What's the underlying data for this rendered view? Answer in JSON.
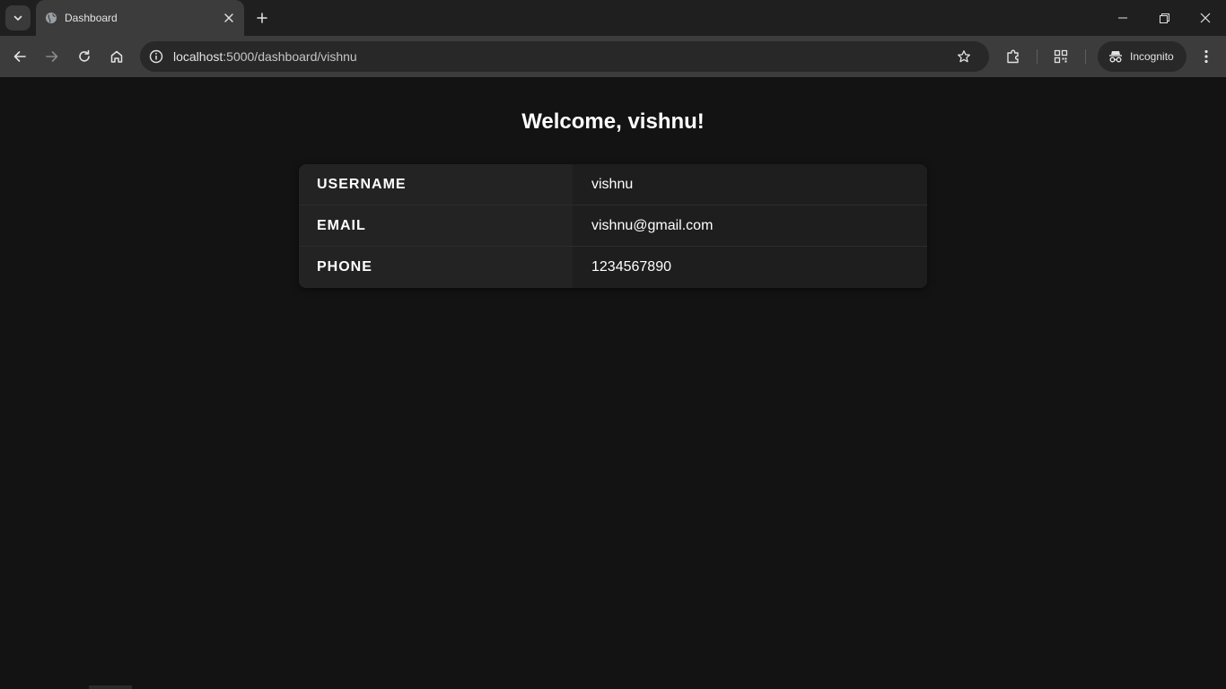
{
  "browser": {
    "tab": {
      "title": "Dashboard",
      "favicon": "globe-icon"
    },
    "url": {
      "host": "localhost",
      "path": ":5000/dashboard/vishnu"
    },
    "profile_label": "Incognito",
    "icons": {
      "tab_search": "chevron-down-icon",
      "new_tab": "plus-icon",
      "back": "arrow-left-icon",
      "forward": "arrow-right-icon",
      "reload": "reload-icon",
      "home": "home-icon",
      "site_info": "info-icon",
      "bookmark": "star-icon",
      "extensions": "puzzle-icon",
      "qr": "qr-code-icon",
      "menu": "kebab-menu-icon"
    }
  },
  "page": {
    "title": "Welcome, vishnu!",
    "rows": [
      {
        "label": "USERNAME",
        "value": "vishnu"
      },
      {
        "label": "EMAIL",
        "value": "vishnu@gmail.com"
      },
      {
        "label": "PHONE",
        "value": "1234567890"
      }
    ]
  },
  "colors": {
    "page_background": "#131313",
    "table_background": "#1e1e1e",
    "toolbar_background": "#3c3c3c"
  }
}
